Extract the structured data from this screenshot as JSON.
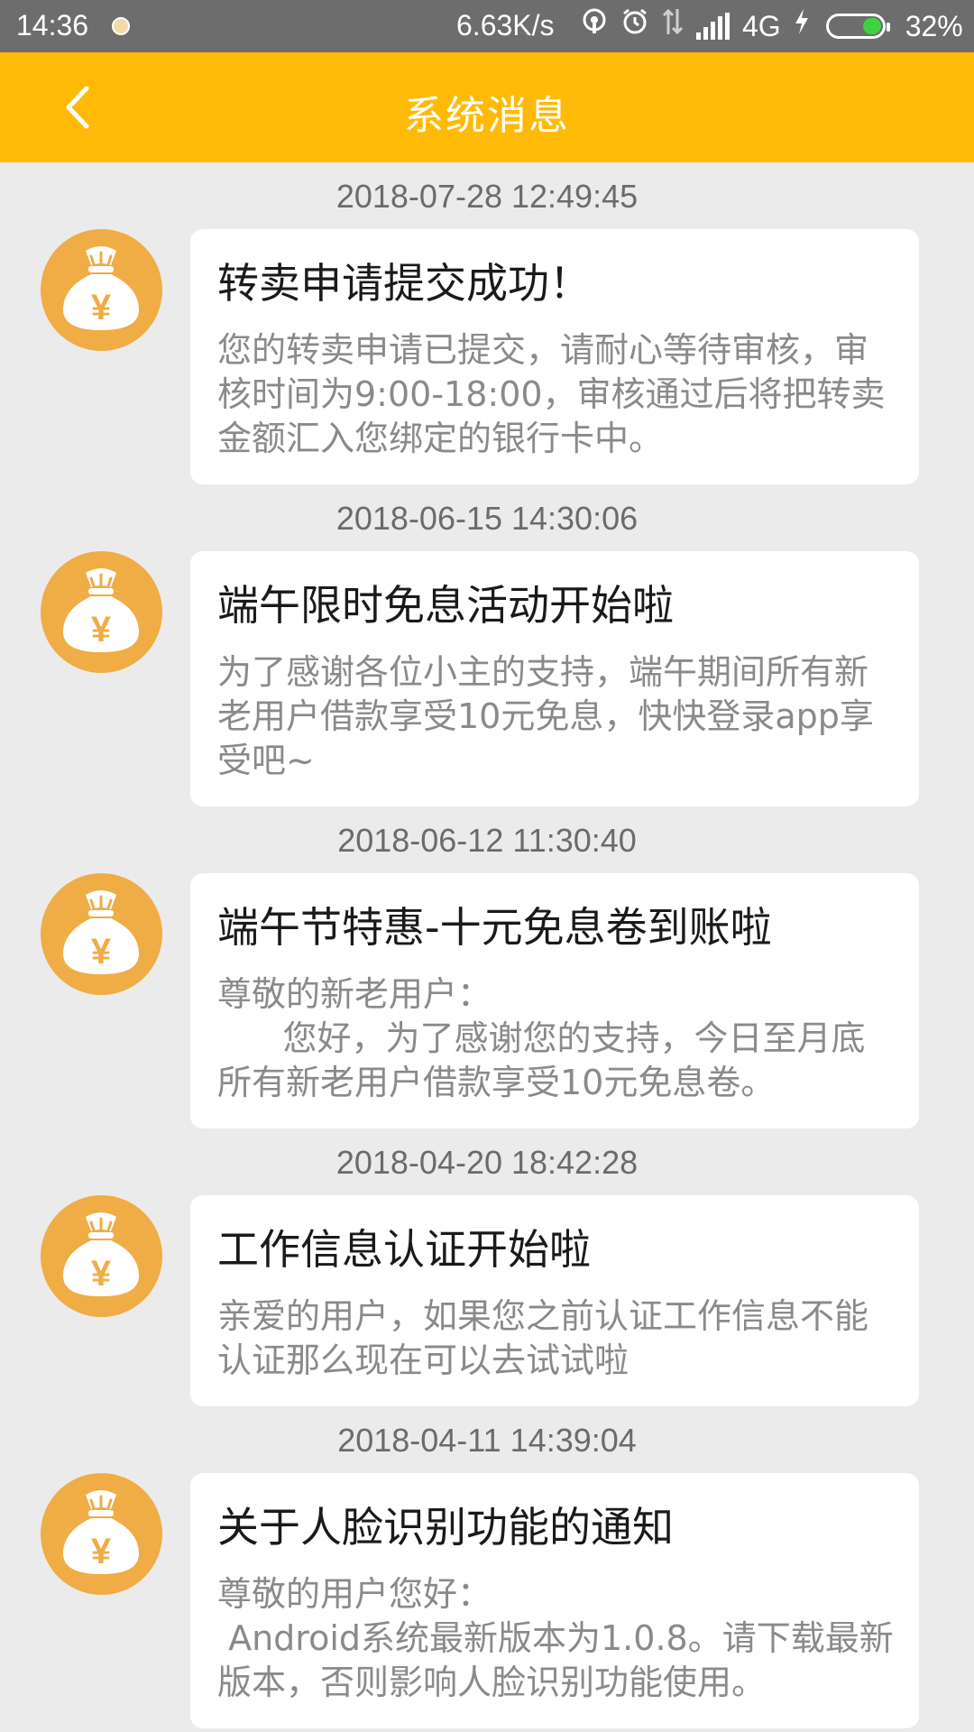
{
  "status_bar": {
    "time": "14:36",
    "speed": "6.63K/s",
    "network": "4G",
    "battery": "32%",
    "icons": [
      "notification-icon",
      "hotspot-icon",
      "alarm-icon",
      "data-icon",
      "signal-icon",
      "charging-icon",
      "battery-icon"
    ]
  },
  "header": {
    "title": "系统消息",
    "back_icon": "chevron-left-icon",
    "bg_color": "#ffba07"
  },
  "avatar_icon": "money-bag-icon",
  "avatar_symbol": "¥",
  "messages": [
    {
      "time": "2018-07-28 12:49:45",
      "title": "转卖申请提交成功！",
      "body": "您的转卖申请已提交，请耐心等待审核，审核时间为9:00-18:00，审核通过后将把转卖金额汇入您绑定的银行卡中。"
    },
    {
      "time": "2018-06-15 14:30:06",
      "title": "端午限时免息活动开始啦",
      "body": "为了感谢各位小主的支持，端午期间所有新老用户借款享受10元免息，快快登录app享受吧~"
    },
    {
      "time": "2018-06-12 11:30:40",
      "title": "端午节特惠-十元免息卷到账啦",
      "body": "尊敬的新老用户：\n      您好，为了感谢您的支持，今日至月底所有新老用户借款享受10元免息卷。"
    },
    {
      "time": "2018-04-20 18:42:28",
      "title": "工作信息认证开始啦",
      "body": "亲爱的用户，如果您之前认证工作信息不能认证那么现在可以去试试啦"
    },
    {
      "time": "2018-04-11 14:39:04",
      "title": "关于人脸识别功能的通知",
      "body": "尊敬的用户您好：\n Android系统最新版本为1.0.8。请下载最新版本，否则影响人脸识别功能使用。"
    }
  ]
}
